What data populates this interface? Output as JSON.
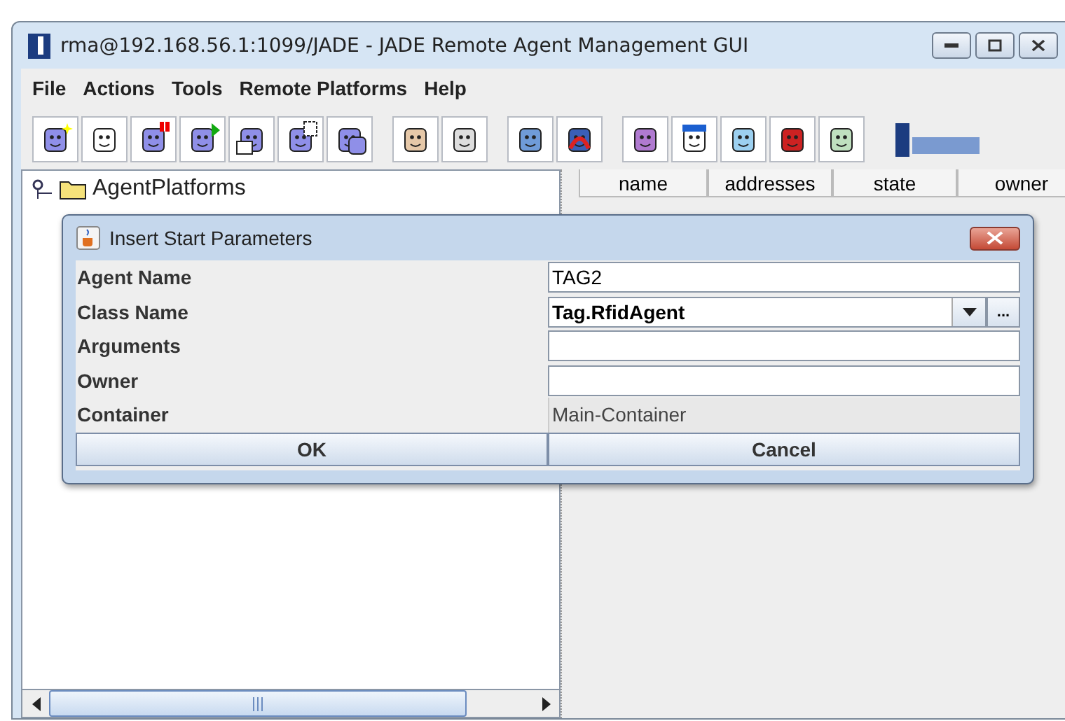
{
  "window": {
    "title": "rma@192.168.56.1:1099/JADE - JADE Remote Agent Management GUI"
  },
  "menu": [
    "File",
    "Actions",
    "Tools",
    "Remote Platforms",
    "Help"
  ],
  "tree": {
    "label": "AgentPlatforms",
    "expanded": true
  },
  "table": {
    "columns": [
      "name",
      "addresses",
      "state",
      "owner"
    ]
  },
  "dialog": {
    "title": "Insert Start Parameters",
    "fields": [
      {
        "label": "Agent Name",
        "kind": "text",
        "value": "TAG2"
      },
      {
        "label": "Class Name",
        "kind": "combo",
        "value": "Tag.RfidAgent",
        "browse": "..."
      },
      {
        "label": "Arguments",
        "kind": "text"
      },
      {
        "label": "Owner",
        "kind": "text"
      },
      {
        "label": "Container",
        "kind": "readonly",
        "value": "Main-Container"
      }
    ],
    "buttons": [
      "OK",
      "Cancel"
    ]
  }
}
